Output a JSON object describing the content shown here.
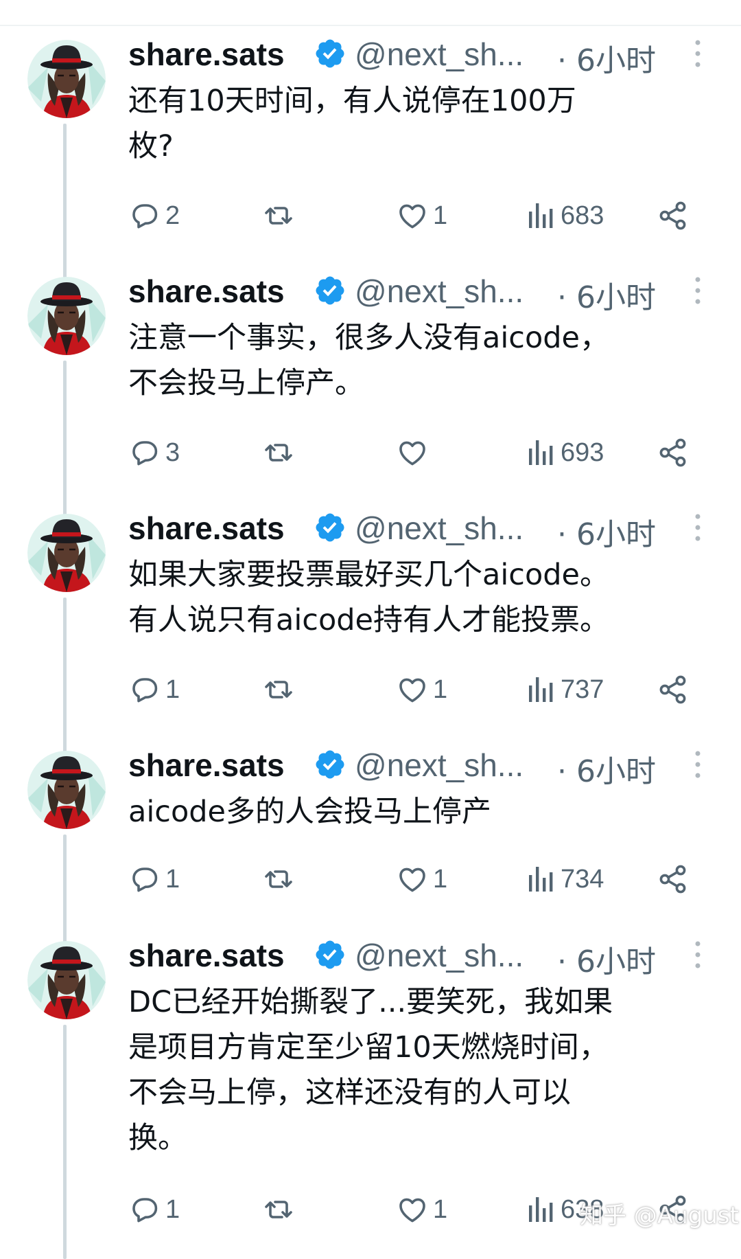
{
  "tweets": [
    {
      "name": "share.sats",
      "handle": "@next_sh...",
      "time": "· 6小时",
      "text": "还有10天时间，有人说停在100万\n枚?",
      "replies": "2",
      "retweets": "",
      "likes": "1",
      "views": "683"
    },
    {
      "name": "share.sats",
      "handle": "@next_sh...",
      "time": "· 6小时",
      "text": "注意一个事实，很多人没有aicode，\n不会投马上停产。",
      "replies": "3",
      "retweets": "",
      "likes": "",
      "views": "693"
    },
    {
      "name": "share.sats",
      "handle": "@next_sh...",
      "time": "· 6小时",
      "text": "如果大家要投票最好买几个aicode。\n有人说只有aicode持有人才能投票。",
      "replies": "1",
      "retweets": "",
      "likes": "1",
      "views": "737"
    },
    {
      "name": "share.sats",
      "handle": "@next_sh...",
      "time": "· 6小时",
      "text": "aicode多的人会投马上停产",
      "replies": "1",
      "retweets": "",
      "likes": "1",
      "views": "734"
    },
    {
      "name": "share.sats",
      "handle": "@next_sh...",
      "time": "· 6小时",
      "text": "DC已经开始撕裂了...要笑死，我如果\n是项目方肯定至少留10天燃烧时间，\n不会马上停，这样还没有的人可以\n换。",
      "replies": "1",
      "retweets": "",
      "likes": "1",
      "views": "638"
    }
  ],
  "icons": {
    "reply": "reply-icon",
    "retweet": "retweet-icon",
    "like": "heart-icon",
    "views": "views-bar-chart-icon",
    "share": "share-icon",
    "verified": "verified-badge-icon",
    "more": "more-vertical-icon"
  },
  "colors": {
    "verified": "#1d9bf0",
    "muted": "#536471",
    "thread_line": "#cfd9de"
  },
  "watermark": "知乎 @August"
}
